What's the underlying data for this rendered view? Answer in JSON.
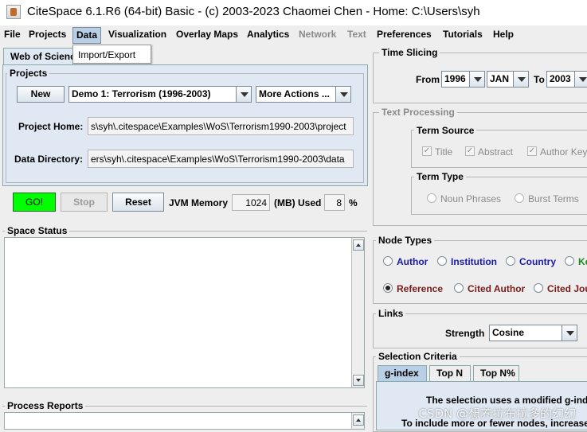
{
  "window": {
    "title": "CiteSpace 6.1.R6 (64-bit) Basic - (c) 2003-2023 Chaomei Chen - Home: C:\\Users\\syh"
  },
  "menu": {
    "file": "File",
    "projects": "Projects",
    "data": "Data",
    "visualization": "Visualization",
    "overlay_maps": "Overlay Maps",
    "analytics": "Analytics",
    "network": "Network",
    "text": "Text",
    "preferences": "Preferences",
    "tutorials": "Tutorials",
    "help": "Help"
  },
  "data_menu_popup": {
    "import_export": "Import/Export"
  },
  "left_tab": "Web of Science",
  "projects": {
    "group_label": "Projects",
    "new_button": "New",
    "project_selected": "Demo 1: Terrorism (1996-2003)",
    "more_actions": "More Actions ...",
    "home_label": "Project Home:",
    "home_value": "s\\syh\\.citespace\\Examples\\WoS\\Terrorism1990-2003\\project",
    "data_dir_label": "Data Directory:",
    "data_dir_value": "ers\\syh\\.citespace\\Examples\\WoS\\Terrorism1990-2003\\data"
  },
  "controls": {
    "go": "GO!",
    "stop": "Stop",
    "reset": "Reset",
    "jvm_label": "JVM Memory",
    "jvm_value": "1024",
    "mb_used_label": "(MB) Used",
    "used_value": "8",
    "percent": "%"
  },
  "colors": {
    "go_green": "#00ff00",
    "accent_blue": "#1a1aa8",
    "reference_red": "#7a1a1a",
    "keyword_green": "#1a8a1a"
  },
  "space_status": {
    "label": "Space Status"
  },
  "process_reports": {
    "label": "Process Reports"
  },
  "time_slicing": {
    "label": "Time Slicing",
    "from_label": "From",
    "from_year": "1996",
    "from_month": "JAN",
    "to_label": "To",
    "to_year": "2003"
  },
  "text_processing": {
    "label": "Text Processing",
    "term_source": {
      "label": "Term Source",
      "title": "Title",
      "abstract": "Abstract",
      "author_keywords": "Author Key"
    },
    "term_type": {
      "label": "Term Type",
      "noun_phrases": "Noun Phrases",
      "burst_terms": "Burst Terms"
    }
  },
  "node_types": {
    "label": "Node Types",
    "author": "Author",
    "institution": "Institution",
    "country": "Country",
    "keyword": "Ke",
    "reference": "Reference",
    "cited_author": "Cited Author",
    "cited_journal": "Cited Jou"
  },
  "links": {
    "label": "Links",
    "strength_label": "Strength",
    "strength_value": "Cosine"
  },
  "selection_criteria": {
    "label": "Selection Criteria",
    "tabs": [
      "g-index",
      "Top N",
      "Top N%"
    ],
    "line1": "The selection uses a modified g-inde",
    "line2": "To include more or fewer nodes, increase"
  },
  "watermark": "CSDN @想养拉布拉多的幻幻"
}
